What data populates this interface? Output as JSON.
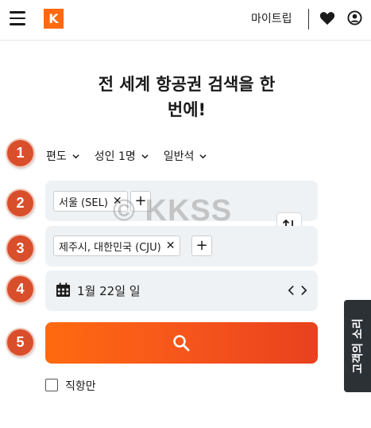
{
  "header": {
    "logo_letter": "K",
    "my_trips": "마이트립",
    "icons": [
      "hamburger-icon",
      "heart-icon",
      "account-icon"
    ]
  },
  "title": {
    "line1": "전 세계 항공권 검색을 한",
    "line2": "번에!"
  },
  "steps": [
    "1",
    "2",
    "3",
    "4",
    "5"
  ],
  "options": {
    "trip_type": "편도",
    "travelers": "성인 1명",
    "cabin": "일반석"
  },
  "origin": {
    "chip": "서울 (SEL)"
  },
  "destination": {
    "chip": "제주시, 대한민국 (CJU)"
  },
  "date": {
    "label": "1월 22일 일"
  },
  "search_button_icon": "search-icon",
  "nonstop_label": "직항만",
  "feedback_label": "고객의 소리",
  "watermark": "© KKSS",
  "colors": {
    "accent": "#ff690f",
    "step": "#d94e2b",
    "panel": "#eff2f4",
    "feedback": "#2c3136"
  }
}
